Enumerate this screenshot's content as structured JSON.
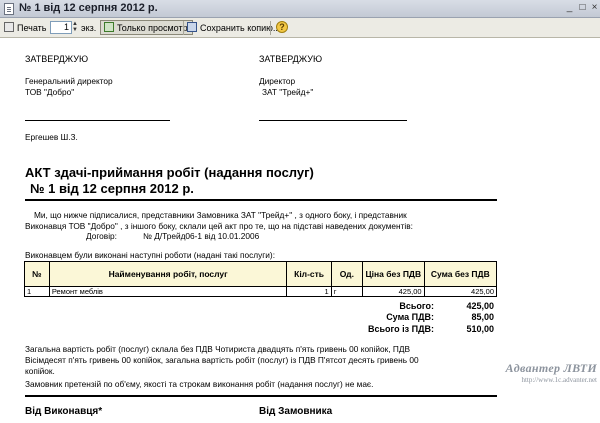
{
  "window": {
    "title": "№ 1 від 12 серпня 2012 р."
  },
  "toolbar": {
    "print_label": "Печать",
    "copies_value": "1",
    "copies_unit": "экз.",
    "view_only_label": "Только просмотр",
    "save_copy_label": "Сохранить копию..."
  },
  "document": {
    "approve_left": {
      "heading": "ЗАТВЕРДЖУЮ",
      "position": "Генеральний директор",
      "company": "ТОВ \"Добро\""
    },
    "approve_right": {
      "heading": "ЗАТВЕРДЖУЮ",
      "position": "Директор",
      "company": "ЗАТ \"Трейд+\""
    },
    "signer": "Ергешев Ш.З.",
    "title_line1": "АКТ здачі-приймання робіт (надання послуг)",
    "title_line2": "№ 1 від 12 серпня 2012 р.",
    "intro_line1": "Ми, що нижче підписалися, представники Замовника  ЗАТ \"Трейд+\" , з одного боку, і представник",
    "intro_line2": "Виконавця  ТОВ \"Добро\" , з іншого боку, склали цей акт про те, що на підставі наведених документів:",
    "contract_label": "Договір:",
    "contract_value": "№ Д/Трейд06-1 від 10.01.2006",
    "performed_text": "Виконавцем були виконані наступні роботи (надані такі послуги):",
    "table": {
      "headers": [
        "№",
        "Найменування робіт, послуг",
        "Кіл-сть",
        "Од.",
        "Ціна без ПДВ",
        "Сума без ПДВ"
      ],
      "rows": [
        [
          "1",
          "Ремонт меблів",
          "1",
          "г",
          "425,00",
          "425,00"
        ]
      ]
    },
    "totals": {
      "total_label": "Всього:",
      "total_value": "425,00",
      "vat_label": "Сума ПДВ:",
      "vat_value": "85,00",
      "total_vat_label": "Всього із ПДВ:",
      "total_vat_value": "510,00"
    },
    "summary_line1": "Загальна вартість робіт (послуг) склала без ПДВ Чотириста двадцять п'ять гривень 00 копійок, ПДВ",
    "summary_line2": "Вісімдесят п'ять гривень 00 копійок, загальна вартість робіт (послуг) із ПДВ П'ятсот десять гривень 00",
    "summary_line3": "копійок.",
    "claims_text": "Замовник претензій по об'єму, якості та строкам виконання робіт (надання послуг) не має.",
    "from_contractor": "Від Виконавця*",
    "from_customer": "Від Замовника"
  },
  "watermark": {
    "brand": "Адвантер ЛВТИ",
    "url": "http://www.1c.advanter.net"
  }
}
